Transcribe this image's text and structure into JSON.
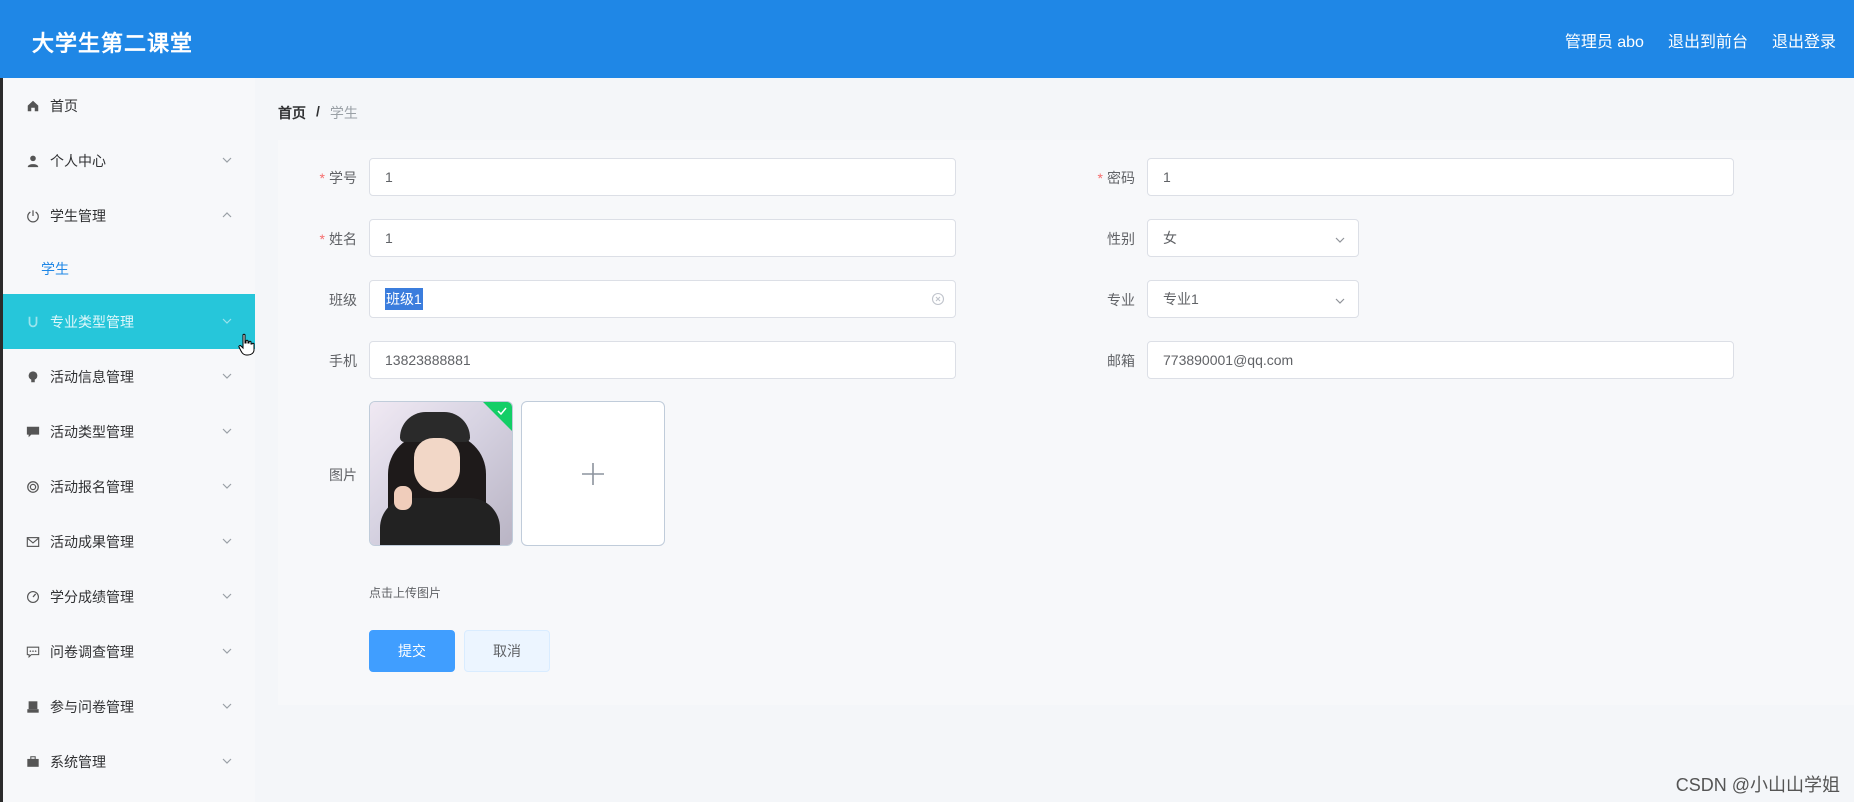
{
  "header": {
    "app_title": "大学生第二课堂",
    "admin_label": "管理员 abo",
    "to_front_label": "退出到前台",
    "logout_label": "退出登录"
  },
  "sidebar": {
    "items": [
      {
        "label": "首页",
        "icon": "home-icon"
      },
      {
        "label": "个人中心",
        "icon": "user-icon"
      },
      {
        "label": "学生管理",
        "icon": "power-icon"
      },
      {
        "label": "学生",
        "icon": ""
      },
      {
        "label": "专业类型管理",
        "icon": "magnet-icon"
      },
      {
        "label": "活动信息管理",
        "icon": "bulb-icon"
      },
      {
        "label": "活动类型管理",
        "icon": "message-icon"
      },
      {
        "label": "活动报名管理",
        "icon": "ring-icon"
      },
      {
        "label": "活动成果管理",
        "icon": "mail-icon"
      },
      {
        "label": "学分成绩管理",
        "icon": "gauge-icon"
      },
      {
        "label": "问卷调查管理",
        "icon": "chat-icon"
      },
      {
        "label": "参与问卷管理",
        "icon": "printer-icon"
      },
      {
        "label": "系统管理",
        "icon": "briefcase-icon"
      }
    ]
  },
  "breadcrumb": {
    "home": "首页",
    "separator": "/",
    "current": "学生"
  },
  "form": {
    "student_no": {
      "label": "学号",
      "value": "1"
    },
    "password": {
      "label": "密码",
      "value": "1"
    },
    "name": {
      "label": "姓名",
      "value": "1"
    },
    "gender": {
      "label": "性别",
      "value": "女"
    },
    "class": {
      "label": "班级",
      "value": "班级1"
    },
    "major": {
      "label": "专业",
      "value": "专业1"
    },
    "phone": {
      "label": "手机",
      "value": "13823888881"
    },
    "email": {
      "label": "邮箱",
      "value": "773890001@qq.com"
    },
    "image": {
      "label": "图片",
      "tip": "点击上传图片"
    },
    "submit_label": "提交",
    "cancel_label": "取消"
  },
  "watermark": "CSDN @小山山学姐",
  "colors": {
    "header_bg": "#1f87e6",
    "sidebar_hover": "#26c6da",
    "primary": "#409eff",
    "required": "#f56c6c"
  }
}
